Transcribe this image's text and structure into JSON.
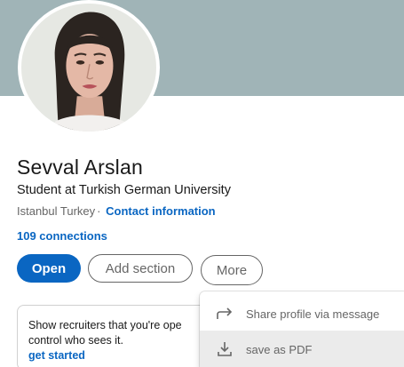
{
  "profile": {
    "name": "Sevval Arslan",
    "headline": "Student at Turkish German University",
    "location": "Istanbul Turkey",
    "separator": "·",
    "contact_label": "Contact information",
    "connections_label": "109 connections"
  },
  "actions": {
    "open_label": "Open",
    "add_section_label": "Add section",
    "more_label": "More"
  },
  "recruiter_card": {
    "line1": "Show recruiters that you're ope",
    "line2": "control who sees it.",
    "cta_label": "get started"
  },
  "more_menu": {
    "items": [
      {
        "icon": "share-arrow-icon",
        "label": "Share profile via message"
      },
      {
        "icon": "download-icon",
        "label": "save as PDF"
      }
    ]
  },
  "colors": {
    "cover": "#a0b4b7",
    "brand_blue": "#0a66c2",
    "muted_text": "#666666",
    "menu_hover": "#ebebeb"
  }
}
